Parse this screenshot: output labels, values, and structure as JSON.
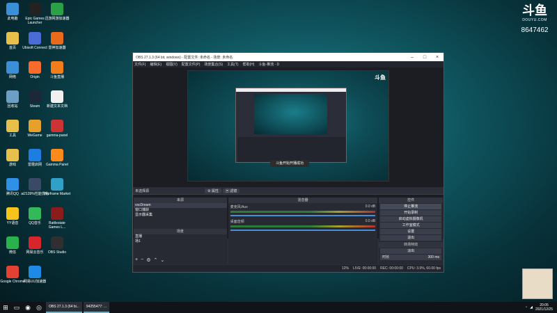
{
  "desktop": {
    "icons": [
      {
        "label": "此电脑",
        "color": "#3b8fd6"
      },
      {
        "label": "Epic Games Launcher",
        "color": "#222222"
      },
      {
        "label": "迅游网游加速器",
        "color": "#2aa146"
      },
      {
        "label": "首页",
        "color": "#e6c04a"
      },
      {
        "label": "Ubisoft Connect",
        "color": "#4b6bd6"
      },
      {
        "label": "雷神加速器",
        "color": "#e86a1a"
      },
      {
        "label": "网络",
        "color": "#3b8fd6"
      },
      {
        "label": "Origin",
        "color": "#f56c2d"
      },
      {
        "label": "斗鱼直播",
        "color": "#f27d1b"
      },
      {
        "label": "回收站",
        "color": "#6d9fc5"
      },
      {
        "label": "Steam",
        "color": "#1b2838"
      },
      {
        "label": "新建文本文档",
        "color": "#f0f0f0"
      },
      {
        "label": "工具",
        "color": "#e6c04a"
      },
      {
        "label": "WeGame",
        "color": "#e5a12b"
      },
      {
        "label": "gamma-panel",
        "color": "#cc3333"
      },
      {
        "label": "游戏",
        "color": "#e6c04a"
      },
      {
        "label": "雷霆启网",
        "color": "#1e7de0"
      },
      {
        "label": "Gamma Panel",
        "color": "#ff8a1c"
      },
      {
        "label": "腾讯QQ",
        "color": "#2f90e8"
      },
      {
        "label": "ai2139%性能优化",
        "color": "#3a4a66"
      },
      {
        "label": "Warframe Market",
        "color": "#2fa0c8"
      },
      {
        "label": "YY语音",
        "color": "#f7c41b"
      },
      {
        "label": "QQ音乐",
        "color": "#33b95a"
      },
      {
        "label": "Battlestate Games L...",
        "color": "#8a1c1c"
      },
      {
        "label": "微信",
        "color": "#29b14b"
      },
      {
        "label": "网易云音乐",
        "color": "#d6262b"
      },
      {
        "label": "OBS Studio",
        "color": "#302e31"
      },
      {
        "label": "Google Chrome",
        "color": "#e34133"
      },
      {
        "label": "网易UU加速器",
        "color": "#1d8be6"
      }
    ]
  },
  "watermark": {
    "logo": "斗鱼",
    "url": "DOUYU.COM",
    "room_id": "8647462"
  },
  "obs": {
    "title": "OBS 27.1.3 (64 bit, windows) - 配置文件: 未命名 - 场景: 未命名",
    "menu": [
      "文件(F)",
      "编辑(E)",
      "视图(V)",
      "配置文件(P)",
      "场景集合(S)",
      "工具(T)",
      "帮助(H)",
      "斗鱼-推流 - D"
    ],
    "preview_toast": "斗鱼开始开播成功",
    "scene_bar": {
      "label": "未选择源",
      "tab1": "⚙ 属性",
      "tab2": "▣ 滤镜"
    },
    "scenes": {
      "header": "来源",
      "items": [
        "vscDream",
        "窗口捕获",
        "显示器采集"
      ]
    },
    "scene_list": {
      "header": "场景",
      "items": [
        "直播",
        "场1"
      ]
    },
    "mixer": {
      "header": "混音器",
      "channels": [
        {
          "name": "麦克风/Aux",
          "db": "0.0 dB"
        },
        {
          "name": "桌面音频",
          "db": "0.0 dB"
        }
      ]
    },
    "controls": {
      "header": "控件",
      "buttons": [
        "停止推流",
        "开始录制",
        "启动虚拟摄像机",
        "工作室模式",
        "设置",
        "退出"
      ]
    },
    "transitions": {
      "header": "转场特效",
      "selected": "淡出",
      "duration_label": "时长",
      "duration_value": "300 ms"
    },
    "status": {
      "live": "LIVE: 00:00:00",
      "rec": "REC: 00:00:00",
      "cpu": "CPU: 3.9%, 60.00 fps",
      "dropped": "12%"
    }
  },
  "taskbar": {
    "tasks": [
      {
        "label": "OBS 27.1.3 (64 bi..."
      },
      {
        "label": "94255477: ..."
      }
    ],
    "time": "20:05",
    "date": "2021/12/25"
  }
}
